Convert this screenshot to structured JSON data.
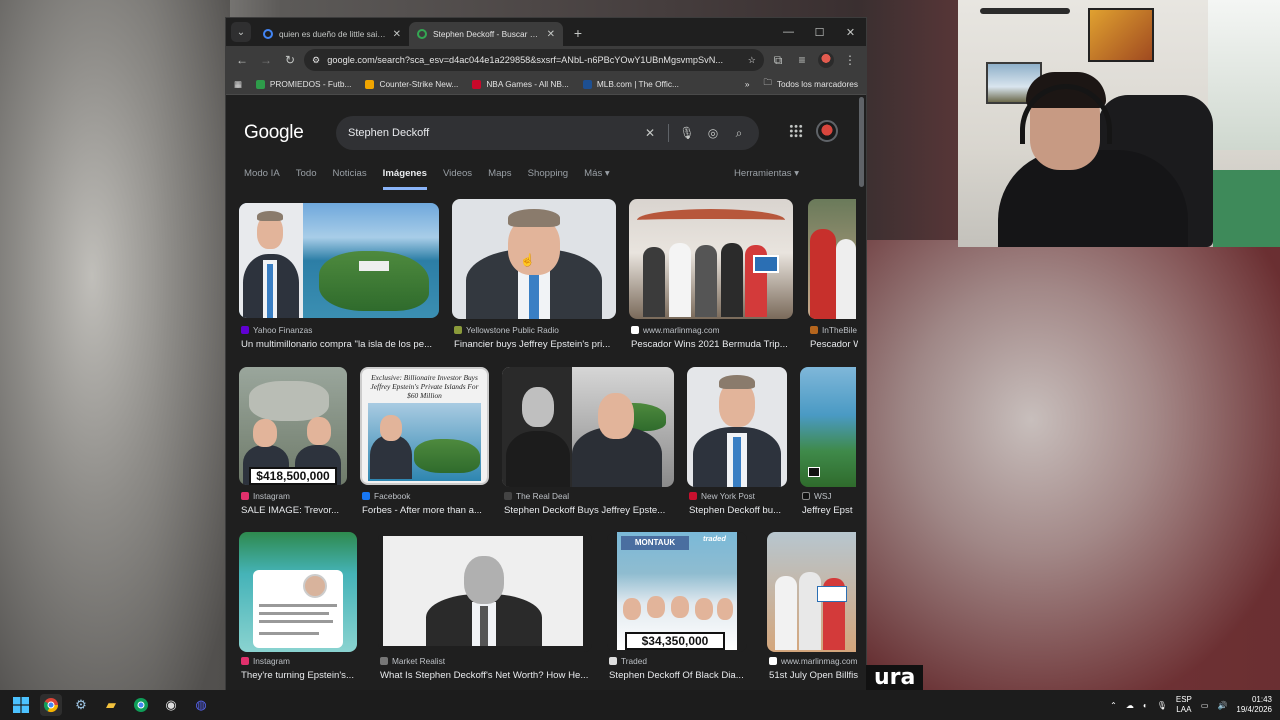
{
  "browser": {
    "tabs": [
      {
        "title": "quien es dueño de little saint ja",
        "active": false
      },
      {
        "title": "Stephen Deckoff - Buscar con G",
        "active": true
      }
    ],
    "url": "google.com/search?sca_esv=d4ac044e1a229858&sxsrf=ANbL-n6PBcYOwY1UBnMgsvmpSvN...",
    "bookmarks": [
      "PROMIEDOS - Futb...",
      "Counter-Strike New...",
      "NBA Games - All NB...",
      "MLB.com | The Offic..."
    ],
    "all_bookmarks": "Todos los marcadores"
  },
  "google": {
    "logo": "Google",
    "query": "Stephen Deckoff",
    "nav": [
      "Modo IA",
      "Todo",
      "Noticias",
      "Imágenes",
      "Videos",
      "Maps",
      "Shopping",
      "Más"
    ],
    "active_nav": "Imágenes",
    "tools": "Herramientas"
  },
  "results": {
    "row1": [
      {
        "source": "Yahoo Finanzas",
        "caption": "Un multimillonario compra \"la isla de los pe..."
      },
      {
        "source": "Yellowstone Public Radio",
        "caption": "Financier buys Jeffrey Epstein's pri..."
      },
      {
        "source": "www.marlinmag.com",
        "caption": "Pescador Wins 2021 Bermuda Trip..."
      },
      {
        "source": "InTheBile",
        "caption": "Pescador W"
      }
    ],
    "row2": [
      {
        "source": "Instagram",
        "caption": "SALE IMAGE: Trevor...",
        "overlay": "$418,500,000"
      },
      {
        "source": "Facebook",
        "caption": "Forbes - After more than a...",
        "headline": "Exclusive: Billionaire Investor Buys Jeffrey Epstein's Private Islands For $60 Million"
      },
      {
        "source": "The Real Deal",
        "caption": "Stephen Deckoff Buys Jeffrey Epste..."
      },
      {
        "source": "New York Post",
        "caption": "Stephen Deckoff bu..."
      },
      {
        "source": "WSJ",
        "caption": "Jeffrey Epst"
      }
    ],
    "row3": [
      {
        "source": "Instagram",
        "caption": "They're turning Epstein's..."
      },
      {
        "source": "Market Realist",
        "caption": "What Is Stephen Deckoff's Net Worth? How He..."
      },
      {
        "source": "Traded",
        "caption": "Stephen Deckoff Of Black Dia...",
        "overlay": "$34,350,000",
        "sign": "MONTAUK",
        "badge": "traded"
      },
      {
        "source": "www.marlinmag.com",
        "caption": "51st July Open Billfis"
      }
    ]
  },
  "overlay_text": "ura",
  "taskbar": {
    "lang_top": "ESP",
    "lang_bottom": "LAA",
    "time": "01:43",
    "date": "19/4/2026"
  },
  "colors": {
    "page_bg": "#1f1f1f",
    "accent": "#8ab4f8",
    "search_bg": "#303134"
  }
}
